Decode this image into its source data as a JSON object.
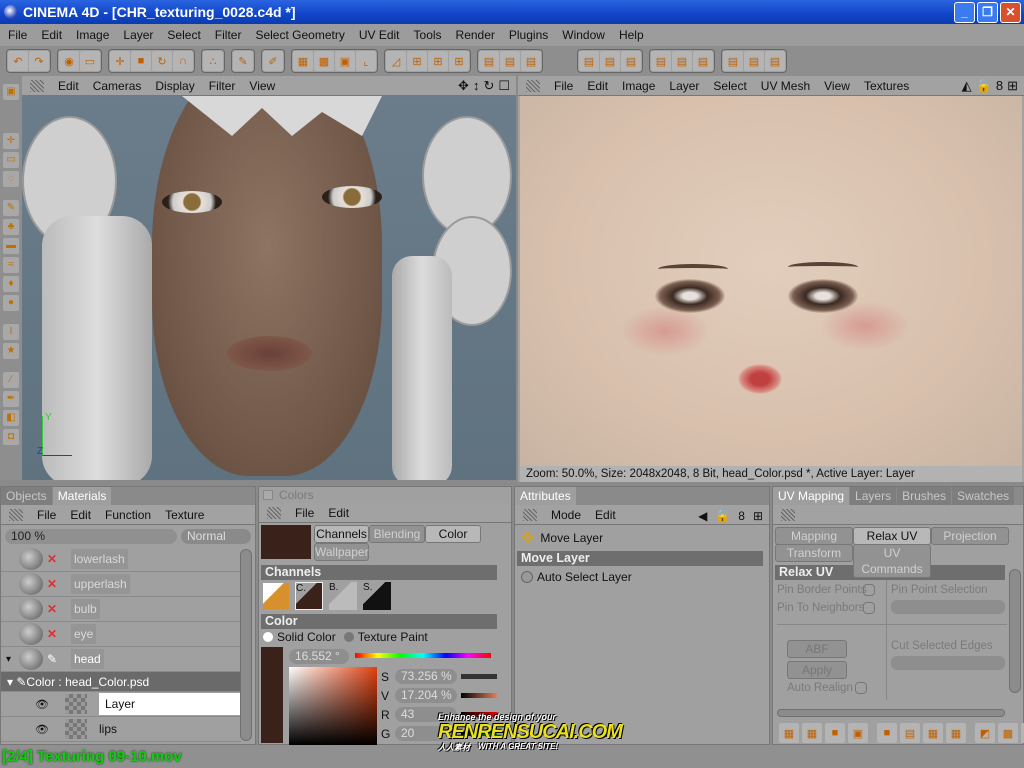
{
  "window": {
    "title": "CINEMA 4D - [CHR_texturing_0028.c4d *]",
    "min": "_",
    "max": "❐",
    "close": "✕"
  },
  "menu": [
    "File",
    "Edit",
    "Image",
    "Layer",
    "Select",
    "Filter",
    "Select Geometry",
    "UV Edit",
    "Tools",
    "Render",
    "Plugins",
    "Window",
    "Help"
  ],
  "viewport3d": {
    "menu": [
      "Edit",
      "Cameras",
      "Display",
      "Filter",
      "View"
    ],
    "axis": {
      "y": "Y",
      "z": "Z"
    }
  },
  "uv_editor": {
    "menu": [
      "File",
      "Edit",
      "Image",
      "Layer",
      "Select",
      "UV Mesh",
      "View",
      "Textures"
    ],
    "status": "Zoom: 50.0%, Size: 2048x2048, 8 Bit, head_Color.psd *, Active Layer: Layer"
  },
  "materials": {
    "tabs": [
      "Objects",
      "Materials"
    ],
    "active_tab": "Materials",
    "menu": [
      "File",
      "Edit",
      "Function",
      "Texture"
    ],
    "opacity": "100 %",
    "blend_mode": "Normal",
    "items": [
      {
        "name": "lowerlash"
      },
      {
        "name": "upperlash"
      },
      {
        "name": "bulb"
      },
      {
        "name": "eye"
      },
      {
        "name": "head"
      }
    ],
    "channel": "Color : head_Color.psd",
    "layers": [
      {
        "name": "Layer",
        "selected": true
      },
      {
        "name": "lips",
        "selected": false
      }
    ]
  },
  "colors": {
    "title": "Colors",
    "menu": [
      "File",
      "Edit"
    ],
    "tabs": [
      "Channels",
      "Blending",
      "Color",
      "Wallpaper"
    ],
    "swatch": "#3a221a",
    "channels_header": "Channels",
    "channels": [
      "C.",
      "B.",
      "S."
    ],
    "color_header": "Color",
    "mode_solid": "Solid Color",
    "mode_texture": "Texture Paint",
    "hue": "16.552 °",
    "s_label": "S",
    "s_value": "73.256 %",
    "v_label": "V",
    "v_value": "17.204 %",
    "r_label": "R",
    "r_value": "43",
    "g_label": "G",
    "g_value": "20"
  },
  "attributes": {
    "tab": "Attributes",
    "menu": [
      "Mode",
      "Edit"
    ],
    "tool": "Move Layer",
    "header": "Move Layer",
    "auto_select": "Auto Select Layer"
  },
  "uvmapping": {
    "tabs": [
      "UV Mapping",
      "Layers",
      "Brushes",
      "Swatches"
    ],
    "subtabs": [
      "Mapping",
      "Relax UV",
      "Projection",
      "Transform",
      "UV Commands"
    ],
    "active_subtab": "Relax UV",
    "header": "Relax UV",
    "pin_border": "Pin Border Points",
    "pin_neighbors": "Pin To Neighbors",
    "pin_point_selection": "Pin Point Selection",
    "method": "ABF",
    "apply": "Apply",
    "auto_realign": "Auto Realign",
    "cut_edges": "Cut Selected Edges"
  },
  "statusbar": {
    "text": "[2/4] Texturing 09-10.mov"
  },
  "watermark": {
    "line1": "Enhance the design of your",
    "line2": "RENRENSUCAI.COM",
    "line3": "人人素材",
    "line4": "WITH A GREAT SITE!"
  }
}
